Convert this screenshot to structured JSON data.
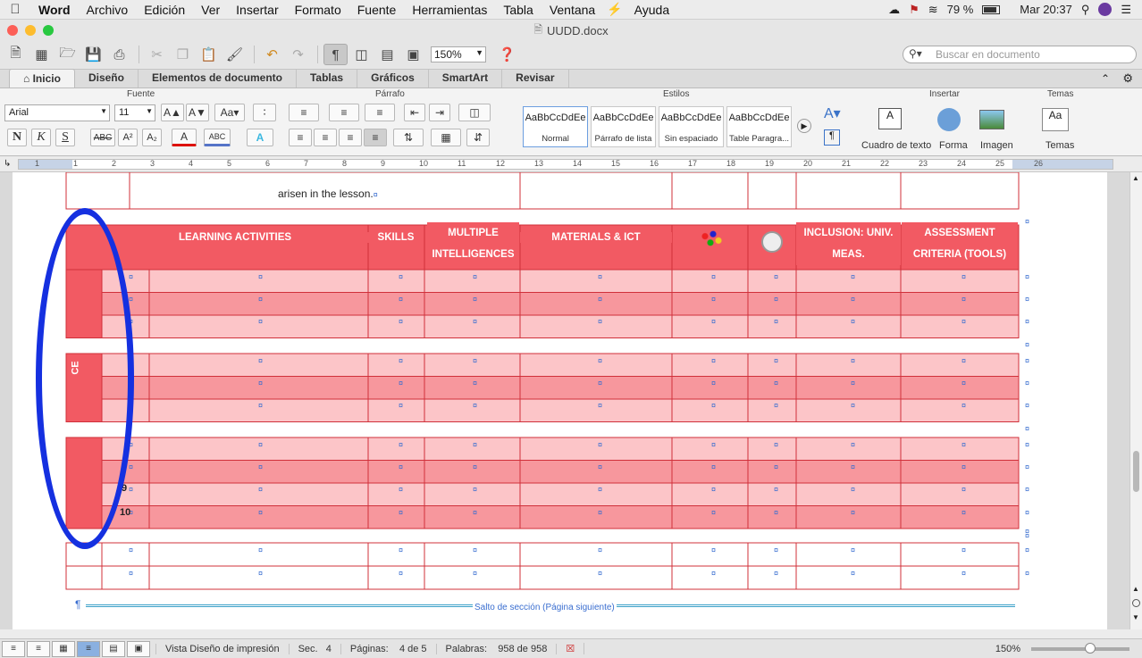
{
  "menubar": {
    "app": "Word",
    "items": [
      "Archivo",
      "Edición",
      "Ver",
      "Insertar",
      "Formato",
      "Fuente",
      "Herramientas",
      "Tabla",
      "Ventana",
      "Ayuda"
    ],
    "battery": "79 %",
    "clock": "Mar 20:37"
  },
  "window": {
    "title": "UUDD.docx"
  },
  "toolbar": {
    "zoom": "150%",
    "search_placeholder": "Buscar en documento"
  },
  "tabs": [
    "Inicio",
    "Diseño",
    "Elementos de documento",
    "Tablas",
    "Gráficos",
    "SmartArt",
    "Revisar"
  ],
  "ribbon": {
    "groups": {
      "fuente": "Fuente",
      "parrafo": "Párrafo",
      "estilos": "Estilos",
      "insertar": "Insertar",
      "temas": "Temas"
    },
    "font_name": "Arial",
    "font_size": "11",
    "styles": [
      {
        "preview": "AaBbCcDdEe",
        "name": "Normal"
      },
      {
        "preview": "AaBbCcDdEe",
        "name": "Párrafo de lista"
      },
      {
        "preview": "AaBbCcDdEe",
        "name": "Sin espaciado"
      },
      {
        "preview": "AaBbCcDdEe",
        "name": "Table Paragra..."
      }
    ],
    "insert": [
      "Cuadro de texto",
      "Forma",
      "Imagen"
    ],
    "themes": "Temas"
  },
  "ruler": {
    "ticks": [
      "1",
      "1",
      "2",
      "3",
      "4",
      "5",
      "6",
      "7",
      "8",
      "9",
      "10",
      "11",
      "12",
      "13",
      "14",
      "15",
      "16",
      "17",
      "18",
      "19",
      "20",
      "21",
      "22",
      "23",
      "24",
      "25",
      "26"
    ]
  },
  "document": {
    "top_text": "arisen in the lesson.",
    "headers": {
      "learning": "LEARNING ACTIVITIES",
      "skills": "SKILLS",
      "multiple": "MULTIPLE INTELLIGENCES",
      "materials": "MATERIALS & ICT",
      "inclusion": "INCLUSION: UNIV. MEAS.",
      "assessment": "ASSESSMENT CRITERIA (TOOLS)"
    },
    "ce_label": "CE",
    "row_numbers": [
      "9",
      "10"
    ],
    "section_break": "Salto de sección (Página siguiente)"
  },
  "status": {
    "view": "Vista Diseño de impresión",
    "sec_label": "Sec.",
    "sec": "4",
    "pages_label": "Páginas:",
    "pages": "4 de 5",
    "words_label": "Palabras:",
    "words": "958 de 958",
    "zoom": "150%"
  },
  "colors": {
    "header": "#f25a63",
    "row_light": "#fcc5c8",
    "row_dark": "#f7979d",
    "border": "#d0303a",
    "annotation": "#1530e0"
  }
}
